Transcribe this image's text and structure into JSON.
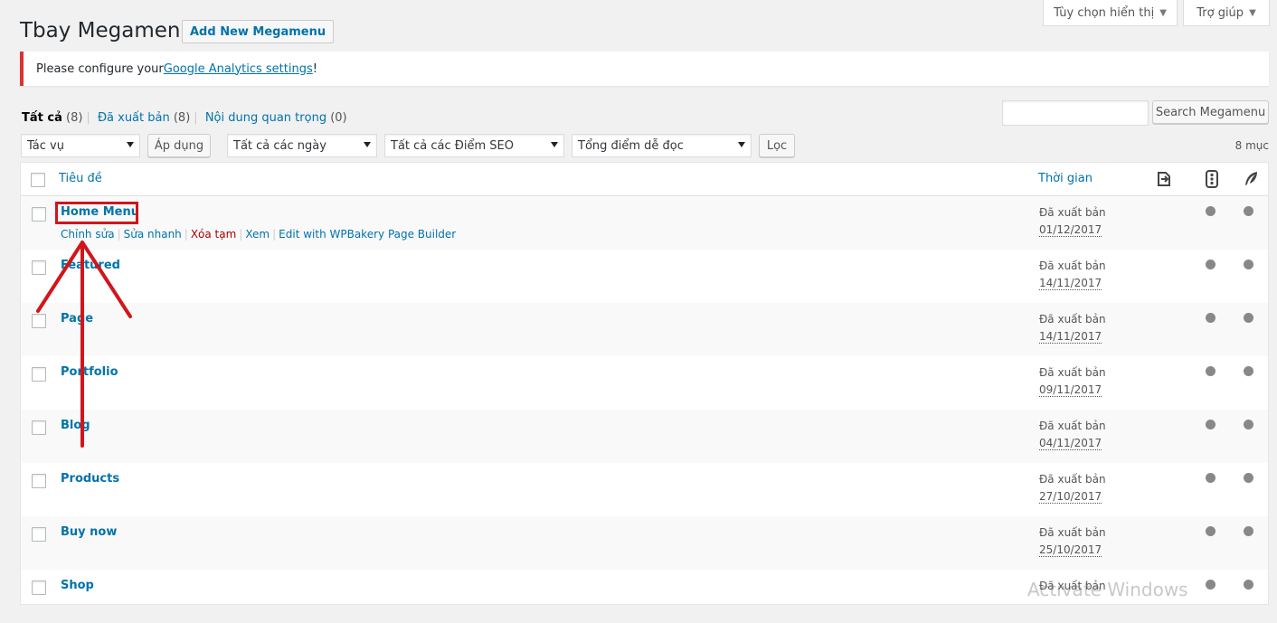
{
  "screen_meta": {
    "display_options_label": "Tùy chọn hiển thị",
    "help_label": "Trợ giúp"
  },
  "header": {
    "title": "Tbay Megamenu",
    "add_new_label": "Add New Megamenu"
  },
  "notice": {
    "prefix": "Please configure your ",
    "link_text": "Google Analytics settings",
    "suffix": "!"
  },
  "views": {
    "all_label": "Tất cả",
    "all_count": "(8)",
    "published_label": "Đã xuất bản",
    "published_count": "(8)",
    "cornerstone_label": "Nội dung quan trọng",
    "cornerstone_count": "(0)"
  },
  "search": {
    "value": "",
    "button_label": "Search Megamenu"
  },
  "filters": {
    "bulk_action": "Tác vụ",
    "apply_label": "Áp dụng",
    "dates": "Tất cả các ngày",
    "seo": "Tất cả các Điểm SEO",
    "readability": "Tổng điểm dễ đọc",
    "filter_label": "Lọc",
    "item_count": "8 mục"
  },
  "table": {
    "col_title": "Tiêu đề",
    "col_date": "Thời gian",
    "col_icons": [
      "links-icon",
      "seo-score-icon",
      "readability-icon"
    ],
    "rows": [
      {
        "title": "Home Menu",
        "status": "Đã xuất bản",
        "date": "01/12/2017"
      },
      {
        "title": "Featured",
        "status": "Đã xuất bản",
        "date": "14/11/2017"
      },
      {
        "title": "Page",
        "status": "Đã xuất bản",
        "date": "14/11/2017"
      },
      {
        "title": "Portfolio",
        "status": "Đã xuất bản",
        "date": "09/11/2017"
      },
      {
        "title": "Blog",
        "status": "Đã xuất bản",
        "date": "04/11/2017"
      },
      {
        "title": "Products",
        "status": "Đã xuất bản",
        "date": "27/10/2017"
      },
      {
        "title": "Buy now",
        "status": "Đã xuất bản",
        "date": "25/10/2017"
      },
      {
        "title": "Shop",
        "status": "Đã xuất bản",
        "date": ""
      }
    ],
    "row_actions": {
      "edit": "Chỉnh sửa",
      "quick_edit": "Sửa nhanh",
      "trash": "Xóa tạm",
      "view": "Xem",
      "wpbakery": "Edit with WPBakery Page Builder"
    }
  },
  "colors": {
    "link": "#0073aa",
    "notice_error": "#dc3232",
    "annotation_red": "#d0161c",
    "score_dot": "#888888"
  },
  "watermark": "Activate Windows"
}
